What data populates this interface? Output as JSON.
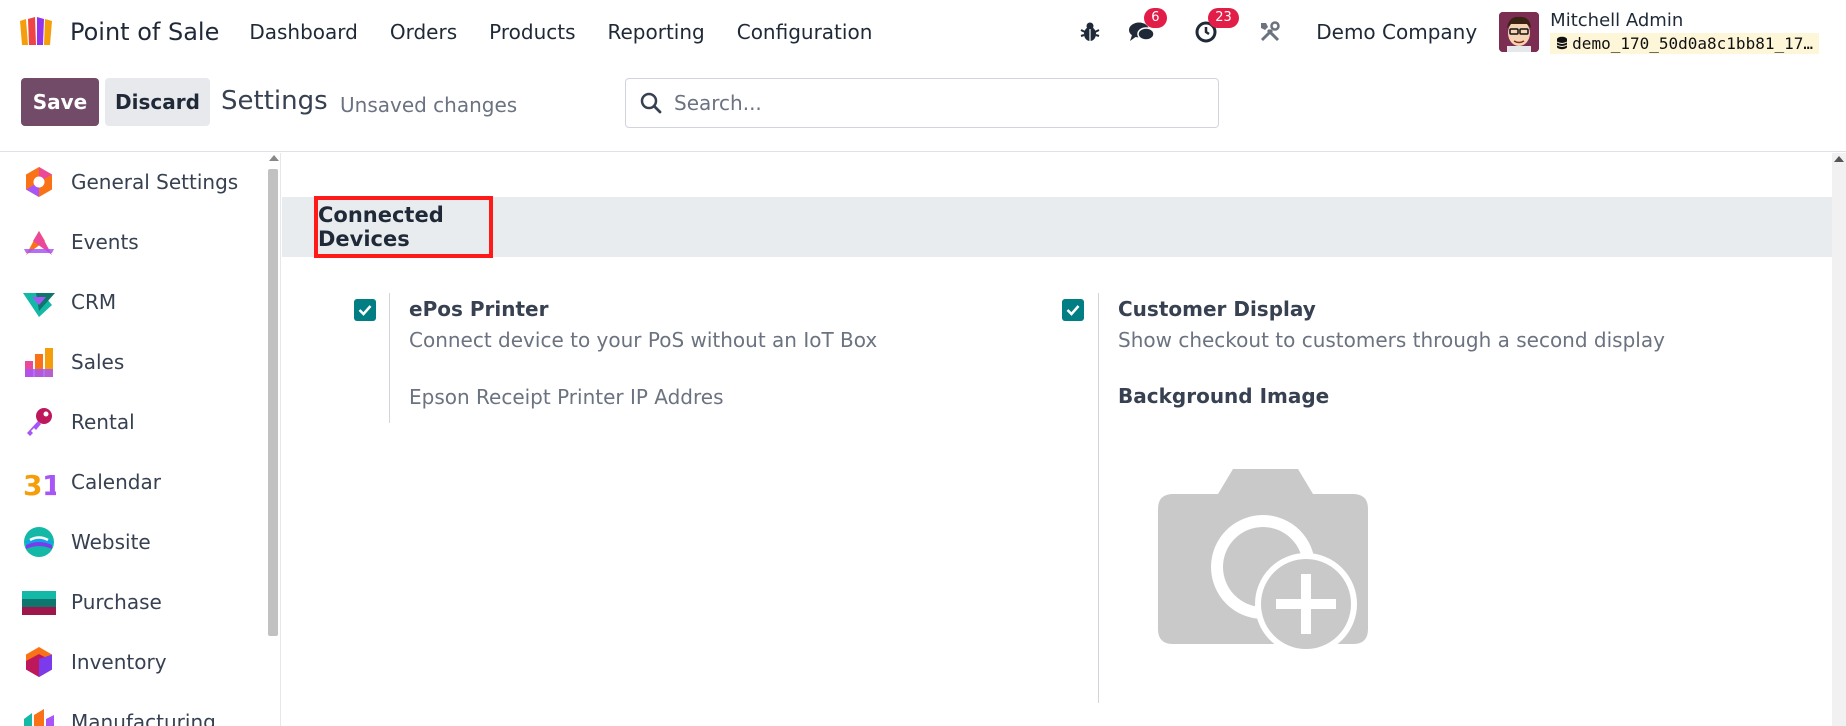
{
  "navbar": {
    "app_name": "Point of Sale",
    "menu": [
      "Dashboard",
      "Orders",
      "Products",
      "Reporting",
      "Configuration"
    ],
    "messages_count": "6",
    "activities_count": "23",
    "company": "Demo Company",
    "user_name": "Mitchell Admin",
    "db_name": "demo_170_50d0a8c1bb81_17…"
  },
  "control_panel": {
    "save_label": "Save",
    "discard_label": "Discard",
    "title": "Settings",
    "status": "Unsaved changes",
    "search_placeholder": "Search..."
  },
  "sidebar": {
    "items": [
      {
        "label": "General Settings",
        "icon": "general-settings-icon"
      },
      {
        "label": "Events",
        "icon": "events-icon"
      },
      {
        "label": "CRM",
        "icon": "crm-icon"
      },
      {
        "label": "Sales",
        "icon": "sales-icon"
      },
      {
        "label": "Rental",
        "icon": "rental-icon"
      },
      {
        "label": "Calendar",
        "icon": "calendar-icon"
      },
      {
        "label": "Website",
        "icon": "website-icon"
      },
      {
        "label": "Purchase",
        "icon": "purchase-icon"
      },
      {
        "label": "Inventory",
        "icon": "inventory-icon"
      },
      {
        "label": "Manufacturing",
        "icon": "manufacturing-icon"
      }
    ]
  },
  "section": {
    "title": "Connected Devices",
    "highlight_color": "#ff1a1a"
  },
  "settings": {
    "epos": {
      "title": "ePos Printer",
      "description": "Connect device to your PoS without an IoT Box",
      "field_label": "Epson Receipt Printer IP Addres",
      "checked": true
    },
    "customer_display": {
      "title": "Customer Display",
      "description": "Show checkout to customers through a second display",
      "field_label": "Background Image",
      "checked": true
    }
  },
  "colors": {
    "primary": "#714b67",
    "checkbox": "#017e84",
    "badge": "#e11d48"
  }
}
